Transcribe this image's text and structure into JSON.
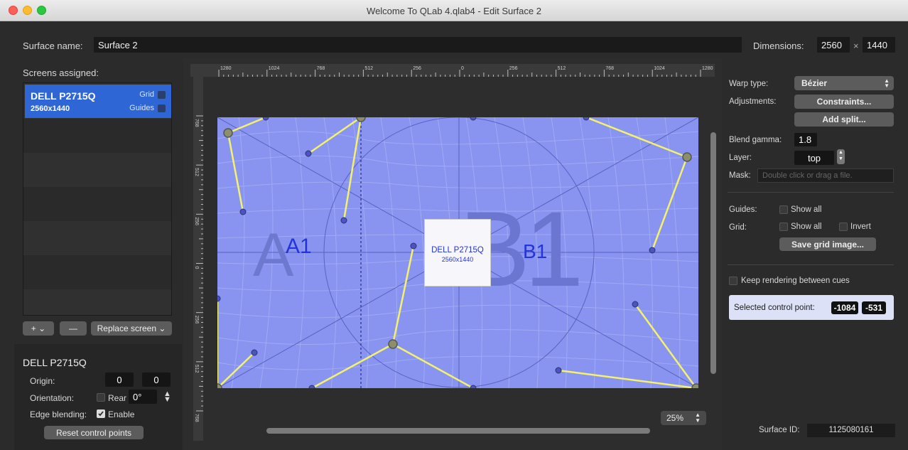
{
  "window": {
    "title": "Welcome To QLab 4.qlab4 - Edit Surface 2"
  },
  "header": {
    "surface_name_label": "Surface name:",
    "surface_name_value": "Surface 2",
    "dimensions_label": "Dimensions:",
    "dim_width": "2560",
    "dim_x": "×",
    "dim_height": "1440"
  },
  "screens": {
    "label": "Screens assigned:",
    "items": [
      {
        "name": "DELL P2715Q",
        "resolution": "2560x1440",
        "grid_label": "Grid",
        "guides_label": "Guides"
      }
    ],
    "add_button": "+ ⌄",
    "remove_button": "—",
    "replace_button": "Replace screen ⌄"
  },
  "screen_detail": {
    "title": "DELL P2715Q",
    "origin_label": "Origin:",
    "origin_x": "0",
    "origin_y": "0",
    "orientation_label": "Orientation:",
    "rear_label": "Rear",
    "rotation_value": "0°",
    "edge_blending_label": "Edge blending:",
    "enable_label": "Enable",
    "reset_button": "Reset control points"
  },
  "canvas": {
    "ruler_top_labels": [
      "1280",
      "1024",
      "768",
      "512",
      "256",
      "0",
      "256",
      "512",
      "768",
      "1024",
      "1280"
    ],
    "ruler_left_labels": [
      "768",
      "512",
      "256",
      "0",
      "256",
      "512",
      "768"
    ],
    "label_a1": "A1",
    "label_b1": "B1",
    "big_a": "A",
    "big_b": "B1",
    "screen_name": "DELL P2715Q",
    "screen_res": "2560x1440",
    "zoom_value": "25%"
  },
  "right_panel": {
    "warp_type_label": "Warp type:",
    "warp_type_value": "Bézier",
    "adjustments_label": "Adjustments:",
    "constraints_button": "Constraints...",
    "add_split_button": "Add split...",
    "blend_gamma_label": "Blend gamma:",
    "blend_gamma_value": "1.8",
    "layer_label": "Layer:",
    "layer_value": "top",
    "mask_label": "Mask:",
    "mask_placeholder": "Double click or drag a file.",
    "guides_label": "Guides:",
    "guides_show_all": "Show all",
    "grid_label": "Grid:",
    "grid_show_all": "Show all",
    "grid_invert": "Invert",
    "save_grid_button": "Save grid image...",
    "keep_rendering_label": "Keep rendering between cues",
    "selected_cp_label": "Selected control point:",
    "selected_cp_x": "-1084",
    "selected_cp_y": "-531",
    "surface_id_label": "Surface ID:",
    "surface_id_value": "1125080161"
  },
  "colors": {
    "surface_fill": "#8894ef",
    "control_line": "#f4f16c",
    "selection_blue": "#2f66d6"
  }
}
